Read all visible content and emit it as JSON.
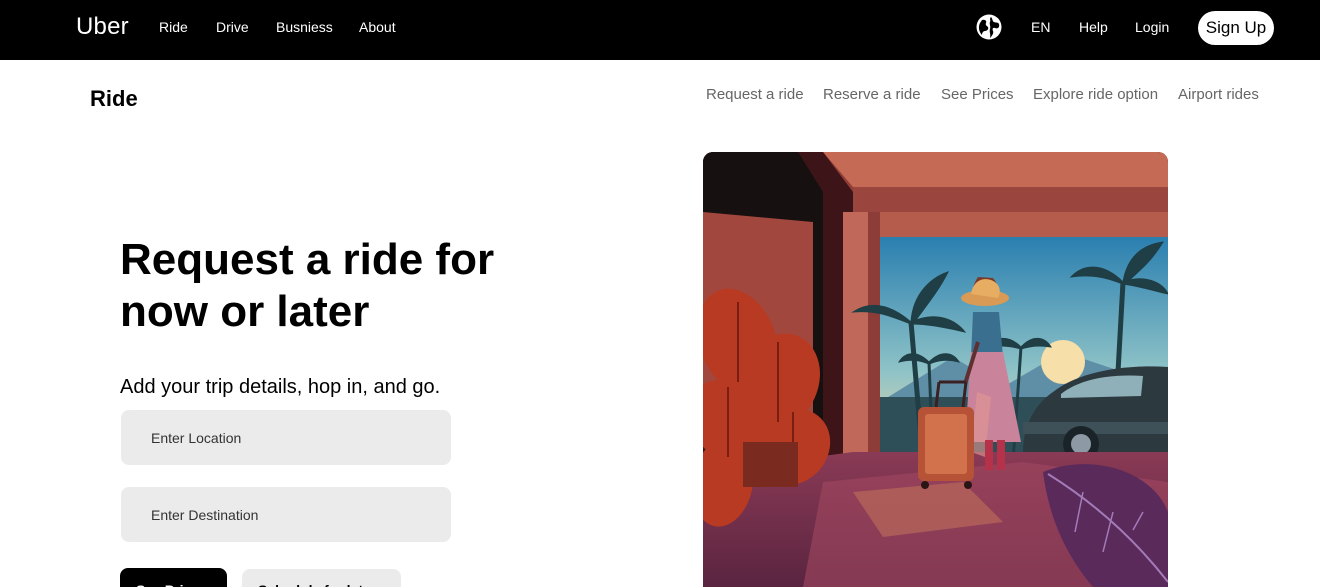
{
  "header": {
    "logo": "Uber",
    "nav": [
      "Ride",
      "Drive",
      "Busniess",
      "About"
    ],
    "language": "EN",
    "help": "Help",
    "login": "Login",
    "signup": "Sign Up",
    "globe_icon": "globe-icon"
  },
  "subheader": {
    "title": "Ride",
    "links": [
      "Request a ride",
      "Reserve a ride",
      "See Prices",
      "Explore ride option",
      "Airport rides"
    ]
  },
  "hero": {
    "title": "Request a ride for now or later",
    "subtitle": "Add your trip details, hop in, and go.",
    "location_placeholder": "Enter Location",
    "destination_placeholder": "Enter Destination",
    "primary_button": "See Prices",
    "secondary_button": "Schedule for later"
  },
  "colors": {
    "header_bg": "#000000",
    "field_bg": "#ebebeb",
    "link_muted": "#666666",
    "illustration_wall": "#a24f44",
    "illustration_floor": "#6e2d4c"
  }
}
